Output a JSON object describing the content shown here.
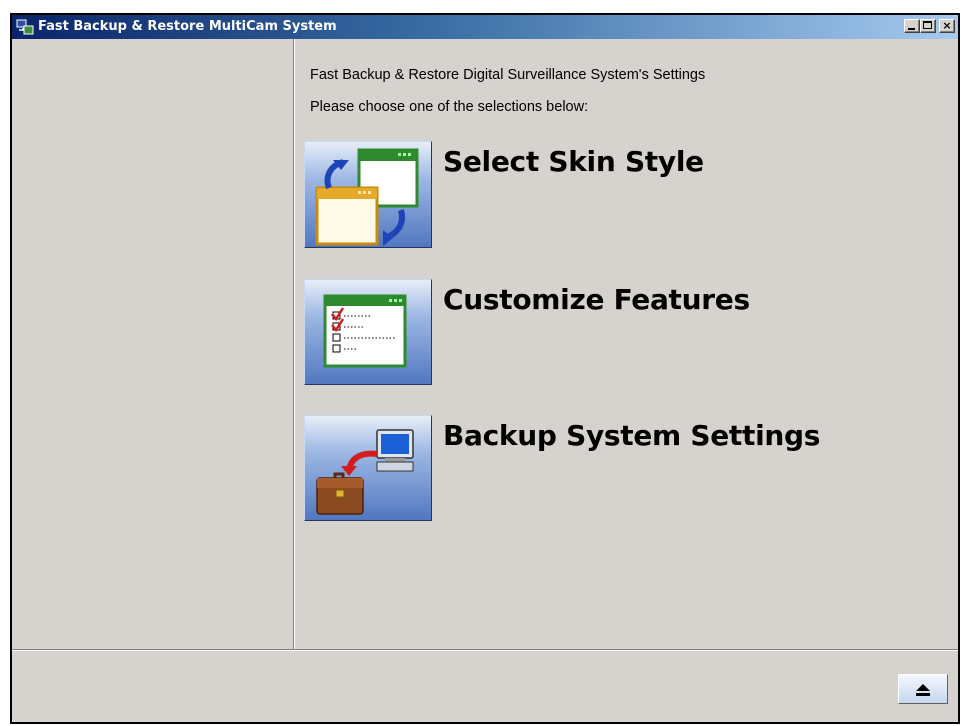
{
  "window": {
    "title": "Fast Backup & Restore MultiCam System",
    "controls": {
      "minimize": "",
      "maximize": "",
      "close": "×"
    }
  },
  "main": {
    "heading_line1": "Fast Backup & Restore Digital Surveillance System's Settings",
    "heading_line2": "Please choose one of the selections below:",
    "options": [
      {
        "label": "Select Skin Style",
        "icon": "skin-windows-icon"
      },
      {
        "label": "Customize Features",
        "icon": "checklist-icon"
      },
      {
        "label": "Backup System Settings",
        "icon": "briefcase-computer-icon"
      }
    ]
  },
  "footer": {
    "eject_icon": "eject-icon"
  },
  "colors": {
    "titlebar_start": "#0a246a",
    "titlebar_end": "#a6caf0",
    "window_bg": "#d6d3ce"
  }
}
